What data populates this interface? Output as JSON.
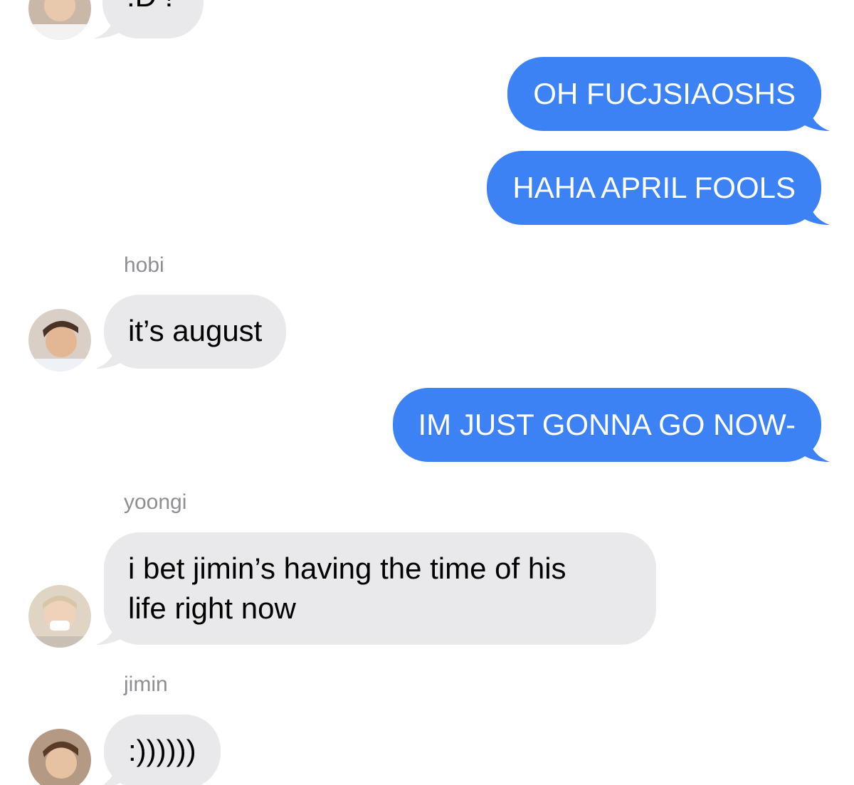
{
  "colors": {
    "outgoing_bubble": "#3c82f5",
    "incoming_bubble": "#e9e9eb",
    "sender_name": "#8e8e93"
  },
  "messages": [
    {
      "direction": "incoming",
      "text": ":D !",
      "avatar": "avatar-person-1"
    },
    {
      "direction": "outgoing",
      "text": "OH FUCJSIAOSHS"
    },
    {
      "direction": "outgoing",
      "text": "HAHA APRIL FOOLS"
    },
    {
      "direction": "incoming",
      "sender": "hobi",
      "text": "it’s august",
      "avatar": "avatar-hobi"
    },
    {
      "direction": "outgoing",
      "text": "IM JUST GONNA GO NOW-"
    },
    {
      "direction": "incoming",
      "sender": "yoongi",
      "lines": [
        "i bet jimin’s having the time of his",
        "life right now"
      ],
      "avatar": "avatar-yoongi"
    },
    {
      "direction": "incoming",
      "sender": "jimin",
      "text": ":))))))",
      "avatar": "avatar-jimin"
    }
  ]
}
